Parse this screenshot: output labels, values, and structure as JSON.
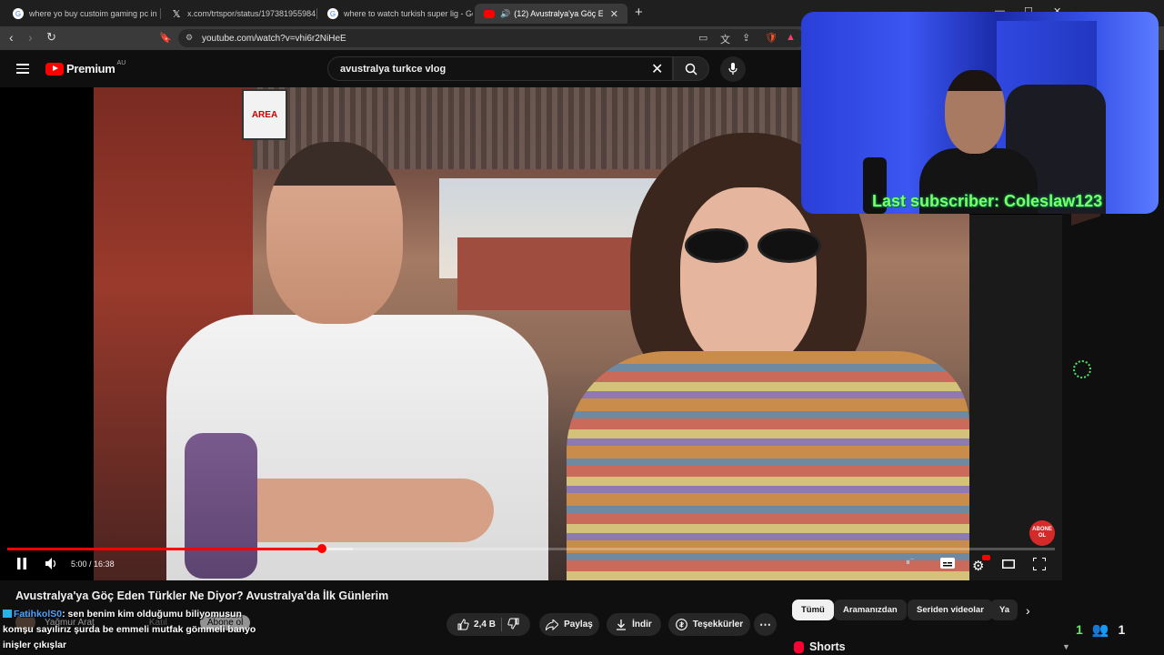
{
  "browser": {
    "tabs": [
      {
        "title": "where yo buy custoim gaming pc in :",
        "icon": "google-icon",
        "active": false
      },
      {
        "title": "x.com/trtspor/status/197381955984",
        "icon": "x-icon",
        "active": false
      },
      {
        "title": "where to watch turkish super lig - Go",
        "icon": "google-icon",
        "active": false
      },
      {
        "title": "(12) Avustralya'ya Göç Eden T",
        "icon": "youtube-icon",
        "active": true
      }
    ],
    "url": "youtube.com/watch?v=vhi6r2NiHeE"
  },
  "youtube": {
    "logo_text": "Premium",
    "region": "AU",
    "search_value": "avustralya turkce vlog"
  },
  "player": {
    "time_current": "5:00",
    "time_separator": " / ",
    "time_total": "16:38",
    "progress_fraction": 0.3006,
    "buffered_fraction": 0.33,
    "sign_text": "AREA",
    "abone_badge": "ABONE OL"
  },
  "stream_overlay": {
    "last_subscriber": "Last subscriber: Coleslaw123"
  },
  "video": {
    "title": "Avustralya'ya Göç Eden Türkler Ne Diyor? Avustralya'da İlk Günlerim",
    "channel": "Yağmur Arat",
    "join_label": "Katıl",
    "subscribe_label": "Abone ol",
    "likes": "2,4 B",
    "share_label": "Paylaş",
    "download_label": "İndir",
    "thanks_label": "Teşekkürler"
  },
  "chat": {
    "user": "FatihkolS0",
    "message_line1": ": sen benim kim olduğumu biliyomusun",
    "message_line2": "komşu sayılırız şurda be emmeli mutfak gömmeli banyo",
    "message_line3": "inişler çıkışlar"
  },
  "chips": [
    "Tümü",
    "Aramanızdan",
    "Seriden videolar",
    "Ya"
  ],
  "shorts_label": "Shorts",
  "viewers": {
    "left_count": "1",
    "right_count": "1"
  },
  "colors": {
    "accent": "#ff0000",
    "overlay_text": "#7dff6a",
    "background": "#0f0f0f"
  }
}
